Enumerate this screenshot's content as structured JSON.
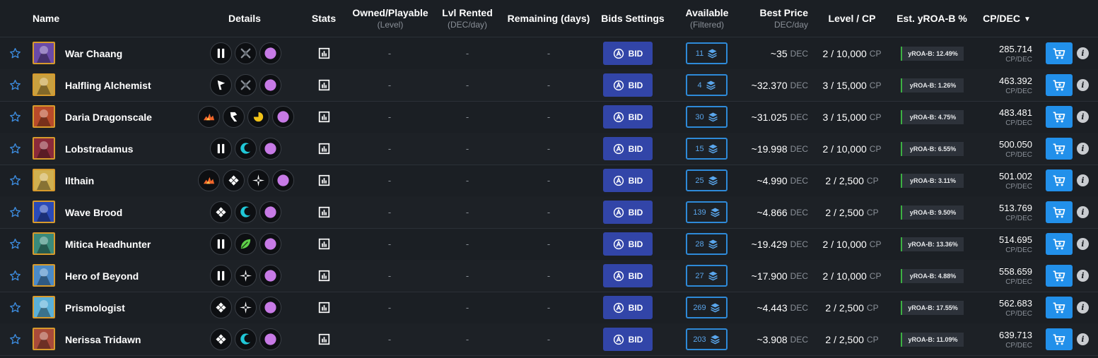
{
  "header": {
    "name": "Name",
    "details": "Details",
    "stats": "Stats",
    "owned": "Owned/Playable",
    "owned_sub": "(Level)",
    "rented": "Lvl Rented",
    "rented_sub": "(DEC/day)",
    "remaining": "Remaining (days)",
    "bids": "Bids Settings",
    "available": "Available",
    "available_sub": "(Filtered)",
    "best_price": "Best Price",
    "best_price_sub": "DEC/day",
    "level_cp": "Level / CP",
    "yroa": "Est. yROA-B %",
    "cpdec": "CP/DEC"
  },
  "labels": {
    "bid": "BID",
    "dash": "-",
    "dec": "DEC",
    "cp": "CP",
    "cpdec": "CP/DEC",
    "info": "i"
  },
  "colors": {
    "accent_blue": "#2290ea",
    "bid_button": "#3245a8",
    "frame_gold": "#d79a2c",
    "yroa_bar": "#3cb043"
  },
  "rows": [
    {
      "name": "War Chaang",
      "details": [
        "melee-icon",
        "no-attack-icon",
        "neutral-element-icon"
      ],
      "available": "11",
      "price": "~35",
      "level_cp": "2 / 10,000",
      "yroa": "yROA-B: 12.49%",
      "cpdec": "285.714",
      "art": "#6a4aa8"
    },
    {
      "name": "Halfling Alchemist",
      "details": [
        "ranged-icon",
        "no-attack-icon",
        "neutral-element-icon"
      ],
      "available": "4",
      "price": "~32.370",
      "level_cp": "3 / 15,000",
      "yroa": "yROA-B: 1.26%",
      "cpdec": "463.392",
      "art": "#c8a040"
    },
    {
      "name": "Daria Dragonscale",
      "details": [
        "fire-element-icon",
        "sneak-icon",
        "earth-element-icon",
        "neutral-element-icon"
      ],
      "available": "30",
      "price": "~31.025",
      "level_cp": "3 / 15,000",
      "yroa": "yROA-B: 4.75%",
      "cpdec": "483.481",
      "art": "#b84a2a"
    },
    {
      "name": "Lobstradamus",
      "details": [
        "melee-icon",
        "water-element-icon",
        "neutral-element-icon"
      ],
      "available": "15",
      "price": "~19.998",
      "level_cp": "2 / 10,000",
      "yroa": "yROA-B: 6.55%",
      "cpdec": "500.050",
      "art": "#8a2a3a"
    },
    {
      "name": "Ilthain",
      "details": [
        "fire-element-icon",
        "magic-diamond-icon",
        "life-element-icon",
        "neutral-element-icon"
      ],
      "available": "25",
      "price": "~4.990",
      "level_cp": "2 / 2,500",
      "yroa": "yROA-B: 3.11%",
      "cpdec": "501.002",
      "art": "#d0b050"
    },
    {
      "name": "Wave Brood",
      "details": [
        "magic-diamond-icon",
        "water-element-icon",
        "neutral-element-icon"
      ],
      "available": "139",
      "price": "~4.866",
      "level_cp": "2 / 2,500",
      "yroa": "yROA-B: 9.50%",
      "cpdec": "513.769",
      "art": "#2a4ab8"
    },
    {
      "name": "Mitica Headhunter",
      "details": [
        "melee-icon",
        "leaf-element-icon",
        "neutral-element-icon"
      ],
      "available": "28",
      "price": "~19.429",
      "level_cp": "2 / 10,000",
      "yroa": "yROA-B: 13.36%",
      "cpdec": "514.695",
      "art": "#3a8a7a"
    },
    {
      "name": "Hero of Beyond",
      "details": [
        "melee-icon",
        "life-element-icon",
        "neutral-element-icon"
      ],
      "available": "27",
      "price": "~17.900",
      "level_cp": "2 / 10,000",
      "yroa": "yROA-B: 4.88%",
      "cpdec": "558.659",
      "art": "#4a8ac8"
    },
    {
      "name": "Prismologist",
      "details": [
        "magic-diamond-icon",
        "life-element-icon",
        "neutral-element-icon"
      ],
      "available": "269",
      "price": "~4.443",
      "level_cp": "2 / 2,500",
      "yroa": "yROA-B: 17.55%",
      "cpdec": "562.683",
      "art": "#5ab0d8"
    },
    {
      "name": "Nerissa Tridawn",
      "details": [
        "magic-diamond-icon",
        "water-element-icon",
        "neutral-element-icon"
      ],
      "available": "203",
      "price": "~3.908",
      "level_cp": "2 / 2,500",
      "yroa": "yROA-B: 11.09%",
      "cpdec": "639.713",
      "art": "#a84a3a"
    }
  ]
}
